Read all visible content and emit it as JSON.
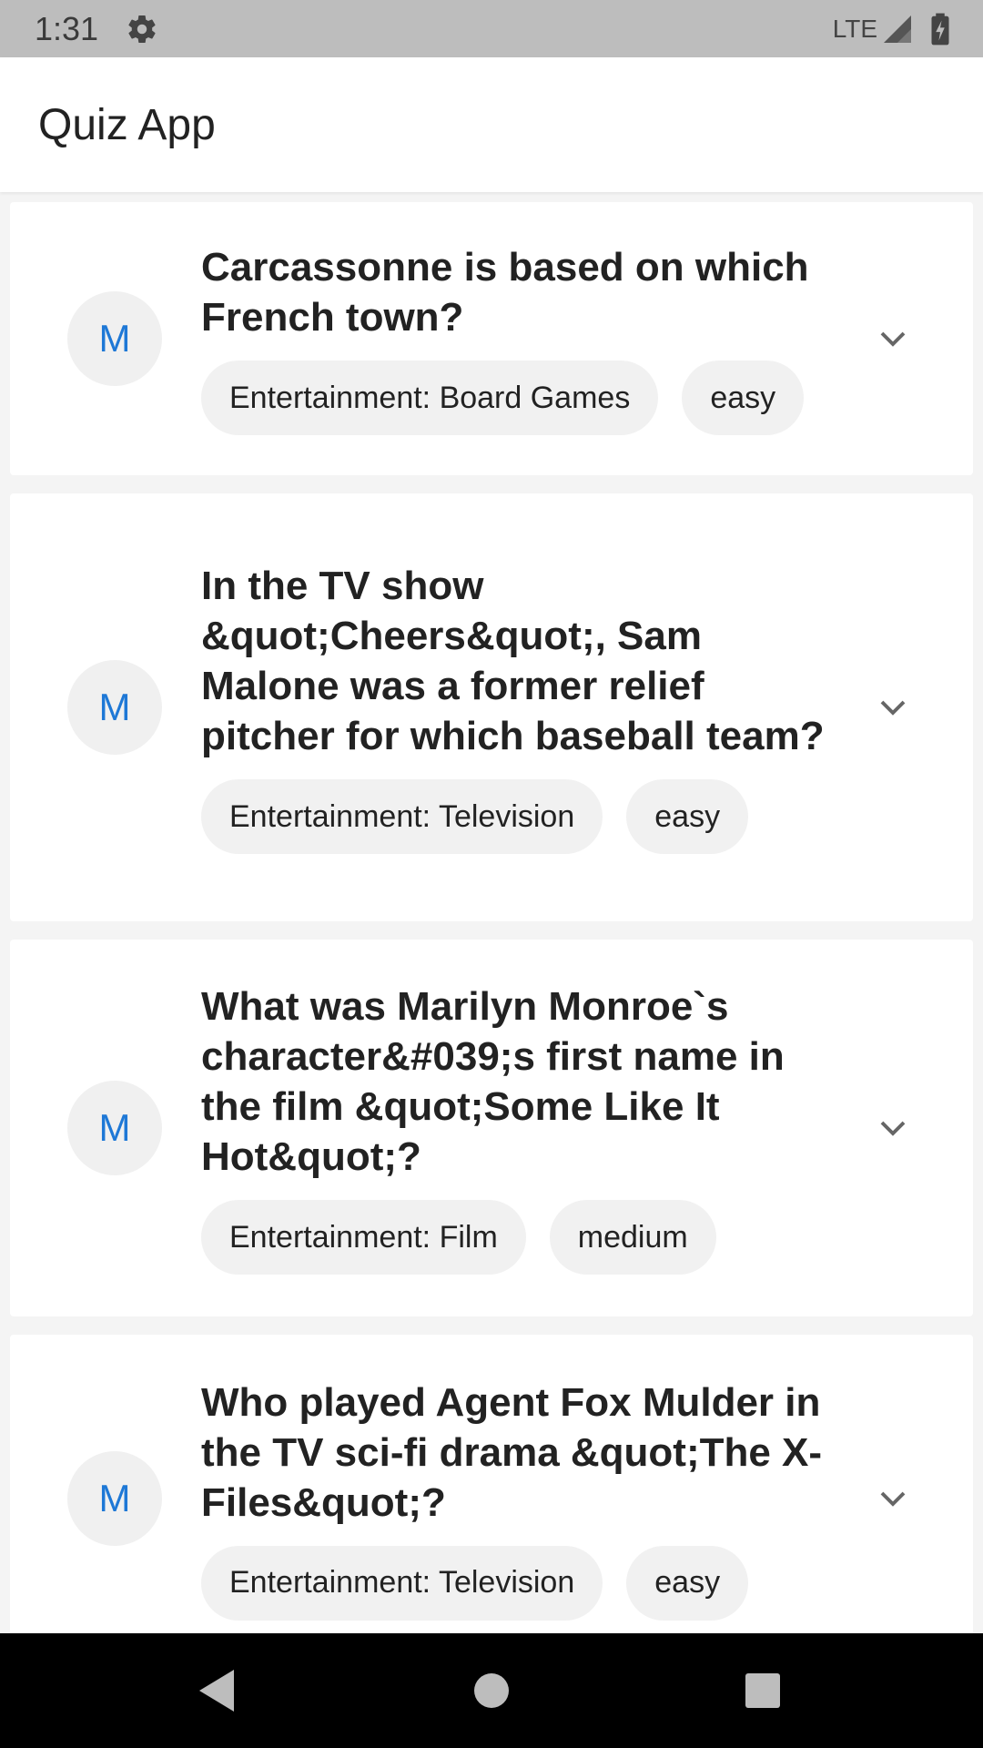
{
  "status_bar": {
    "time": "1:31",
    "network": "LTE",
    "icons": [
      "gear-icon",
      "signal-icon",
      "battery-icon"
    ]
  },
  "app_bar": {
    "title": "Quiz App"
  },
  "colors": {
    "status_bar_bg": "#bdbdbd",
    "app_bar_bg": "#ffffff",
    "list_bg": "#f4f4f4",
    "avatar_text": "#1e78d6",
    "chip_bg": "#f1f1f1",
    "nav_bar_bg": "#000000"
  },
  "questions": [
    {
      "avatar": "M",
      "question": "Carcassonne is based on which French town?",
      "category": "Entertainment: Board Games",
      "difficulty": "easy"
    },
    {
      "avatar": "M",
      "question": "In the TV show &quot;Cheers&quot;, Sam Malone was a former relief pitcher for which baseball team?",
      "category": "Entertainment: Television",
      "difficulty": "easy"
    },
    {
      "avatar": "M",
      "question": "What was Marilyn Monroe`s character&#039;s first name in the film &quot;Some Like It Hot&quot;?",
      "category": "Entertainment: Film",
      "difficulty": "medium"
    },
    {
      "avatar": "M",
      "question": "Who played Agent Fox Mulder in the TV sci-fi drama &quot;The X-Files&quot;?",
      "category": "Entertainment: Television",
      "difficulty": "easy"
    }
  ],
  "nav_bar": {
    "icons": [
      "back-icon",
      "home-icon",
      "recents-icon"
    ]
  }
}
